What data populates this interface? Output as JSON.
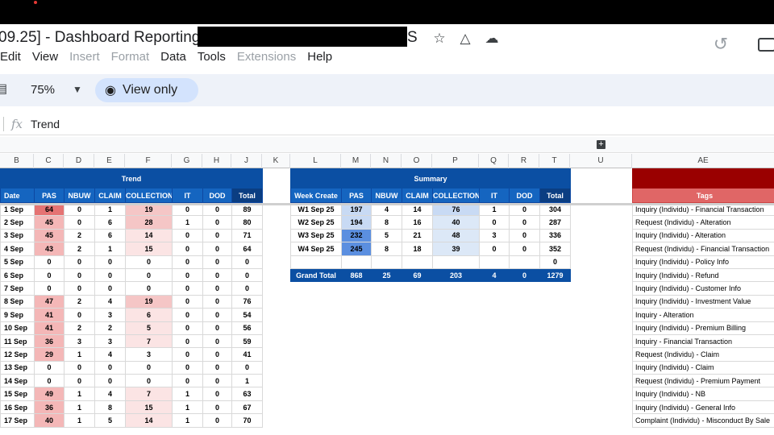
{
  "doc": {
    "title": "09.25] - Dashboard Reporting",
    "title_tail": "S"
  },
  "menu": [
    {
      "label": "Edit",
      "enabled": true
    },
    {
      "label": "View",
      "enabled": true
    },
    {
      "label": "Insert",
      "enabled": false
    },
    {
      "label": "Format",
      "enabled": false
    },
    {
      "label": "Data",
      "enabled": true
    },
    {
      "label": "Tools",
      "enabled": true
    },
    {
      "label": "Extensions",
      "enabled": false
    },
    {
      "label": "Help",
      "enabled": true
    }
  ],
  "toolbar": {
    "zoom": "75%",
    "view_only": "View only"
  },
  "formula": {
    "value": "Trend"
  },
  "columns": {
    "B": "B",
    "C": "C",
    "D": "D",
    "E": "E",
    "F": "F",
    "G": "G",
    "H": "H",
    "J": "J",
    "K": "K",
    "L": "L",
    "M": "M",
    "N": "N",
    "O": "O",
    "P": "P",
    "Q": "Q",
    "R": "R",
    "T": "T",
    "U": "U",
    "AE": "AE"
  },
  "trend": {
    "title": "Trend",
    "headers": [
      "Date",
      "PAS",
      "NBUW",
      "CLAIM",
      "COLLECTION",
      "IT",
      "DOD",
      "Total"
    ],
    "rows": [
      [
        "1 Sep",
        "64",
        "0",
        "1",
        "19",
        "0",
        "0",
        "89"
      ],
      [
        "2 Sep",
        "45",
        "0",
        "6",
        "28",
        "1",
        "0",
        "80"
      ],
      [
        "3 Sep",
        "45",
        "2",
        "6",
        "14",
        "0",
        "0",
        "71"
      ],
      [
        "4 Sep",
        "43",
        "2",
        "1",
        "15",
        "0",
        "0",
        "64"
      ],
      [
        "5 Sep",
        "0",
        "0",
        "0",
        "0",
        "0",
        "0",
        "0"
      ],
      [
        "6 Sep",
        "0",
        "0",
        "0",
        "0",
        "0",
        "0",
        "0"
      ],
      [
        "7 Sep",
        "0",
        "0",
        "0",
        "0",
        "0",
        "0",
        "0"
      ],
      [
        "8 Sep",
        "47",
        "2",
        "4",
        "19",
        "0",
        "0",
        "76"
      ],
      [
        "9 Sep",
        "41",
        "0",
        "3",
        "6",
        "0",
        "0",
        "54"
      ],
      [
        "10 Sep",
        "41",
        "2",
        "2",
        "5",
        "0",
        "0",
        "56"
      ],
      [
        "11 Sep",
        "36",
        "3",
        "3",
        "7",
        "0",
        "0",
        "59"
      ],
      [
        "12 Sep",
        "29",
        "1",
        "4",
        "3",
        "0",
        "0",
        "41"
      ],
      [
        "13 Sep",
        "0",
        "0",
        "0",
        "0",
        "0",
        "0",
        "0"
      ],
      [
        "14 Sep",
        "0",
        "0",
        "0",
        "0",
        "0",
        "0",
        "1"
      ],
      [
        "15 Sep",
        "49",
        "1",
        "4",
        "7",
        "1",
        "0",
        "63"
      ],
      [
        "16 Sep",
        "36",
        "1",
        "8",
        "15",
        "1",
        "0",
        "67"
      ],
      [
        "17 Sep",
        "40",
        "1",
        "5",
        "14",
        "1",
        "0",
        "70"
      ]
    ]
  },
  "summary": {
    "title": "Summary",
    "headers": [
      "Week Create",
      "PAS",
      "NBUW",
      "CLAIM",
      "COLLECTION",
      "IT",
      "DOD",
      "Total"
    ],
    "rows": [
      [
        "W1 Sep 25",
        "197",
        "4",
        "14",
        "76",
        "1",
        "0",
        "304"
      ],
      [
        "W2 Sep 25",
        "194",
        "8",
        "16",
        "40",
        "0",
        "0",
        "287"
      ],
      [
        "W3 Sep 25",
        "232",
        "5",
        "21",
        "48",
        "3",
        "0",
        "336"
      ],
      [
        "W4 Sep 25",
        "245",
        "8",
        "18",
        "39",
        "0",
        "0",
        "352"
      ],
      [
        "",
        "",
        "",
        "",
        "",
        "",
        "",
        "0"
      ]
    ],
    "grand_total": [
      "Grand Total",
      "868",
      "25",
      "69",
      "203",
      "4",
      "0",
      "1279"
    ]
  },
  "tags": {
    "header": "Tags",
    "items": [
      "Inquiry (Individu) - Financial Transaction",
      "Request (Individu) - Alteration",
      "Inquiry (Individu) - Alteration",
      "Request (Individu) - Financial Transaction",
      "Inquiry (Individu) - Policy Info",
      "Inquiry (Individu) - Refund",
      "Inquiry (Individu) - Customer Info",
      "Inquiry (Individu) - Investment Value",
      "Inquiry - Alteration",
      "Inquiry (Individu) - Premium Billing",
      "Inquiry - Financial Transaction",
      "Request (Individu) - Claim",
      "Inquiry (Individu) - Claim",
      "Request (Individu) - Premium Payment",
      "Inquiry (Individu) - NB",
      "Inquiry (Individu) - General Info",
      "Complaint (Individu) - Misconduct By Sale"
    ]
  }
}
